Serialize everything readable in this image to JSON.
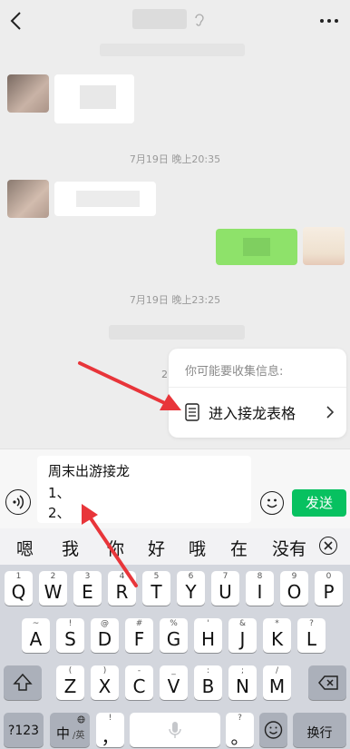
{
  "nav": {
    "back_icon": "chevron-left-icon",
    "more_icon": "ellipsis-icon"
  },
  "chat": {
    "timestamps": [
      "7月19日 晚上20:35",
      "7月19日 晚上23:25"
    ],
    "partial_text": "2"
  },
  "popup": {
    "hint": "你可能要收集信息:",
    "action_label": "进入接龙表格",
    "action_icon": "list-icon"
  },
  "input": {
    "lines": [
      "周末出游接龙",
      "1、",
      "2、"
    ],
    "send_label": "发送"
  },
  "candidates": [
    "嗯",
    "我",
    "你",
    "好",
    "哦",
    "在",
    "没有"
  ],
  "keyboard": {
    "row1": [
      {
        "main": "Q",
        "sub": "1"
      },
      {
        "main": "W",
        "sub": "2"
      },
      {
        "main": "E",
        "sub": "3"
      },
      {
        "main": "R",
        "sub": "4"
      },
      {
        "main": "T",
        "sub": "5"
      },
      {
        "main": "Y",
        "sub": "6"
      },
      {
        "main": "U",
        "sub": "7"
      },
      {
        "main": "I",
        "sub": "8"
      },
      {
        "main": "O",
        "sub": "9"
      },
      {
        "main": "P",
        "sub": "0"
      }
    ],
    "row2": [
      {
        "main": "A",
        "sub": "~"
      },
      {
        "main": "S",
        "sub": "!"
      },
      {
        "main": "D",
        "sub": "@"
      },
      {
        "main": "F",
        "sub": "#"
      },
      {
        "main": "G",
        "sub": "%"
      },
      {
        "main": "H",
        "sub": "'"
      },
      {
        "main": "J",
        "sub": "&"
      },
      {
        "main": "K",
        "sub": "*"
      },
      {
        "main": "L",
        "sub": "?"
      }
    ],
    "row3": [
      {
        "main": "Z",
        "sub": "("
      },
      {
        "main": "X",
        "sub": ")"
      },
      {
        "main": "C",
        "sub": "-"
      },
      {
        "main": "V",
        "sub": "_"
      },
      {
        "main": "B",
        "sub": ":"
      },
      {
        "main": "N",
        "sub": ";"
      },
      {
        "main": "M",
        "sub": "/"
      }
    ],
    "symbol_key": "?123",
    "lang_key": "中",
    "lang_key_alt": "/英",
    "comma_key": "，",
    "comma_key_sub": "!",
    "period_key": "。",
    "period_key_sub": "?",
    "return_key": "换行"
  },
  "colors": {
    "accent": "#07c160",
    "bubble_green": "#8ee26a"
  }
}
